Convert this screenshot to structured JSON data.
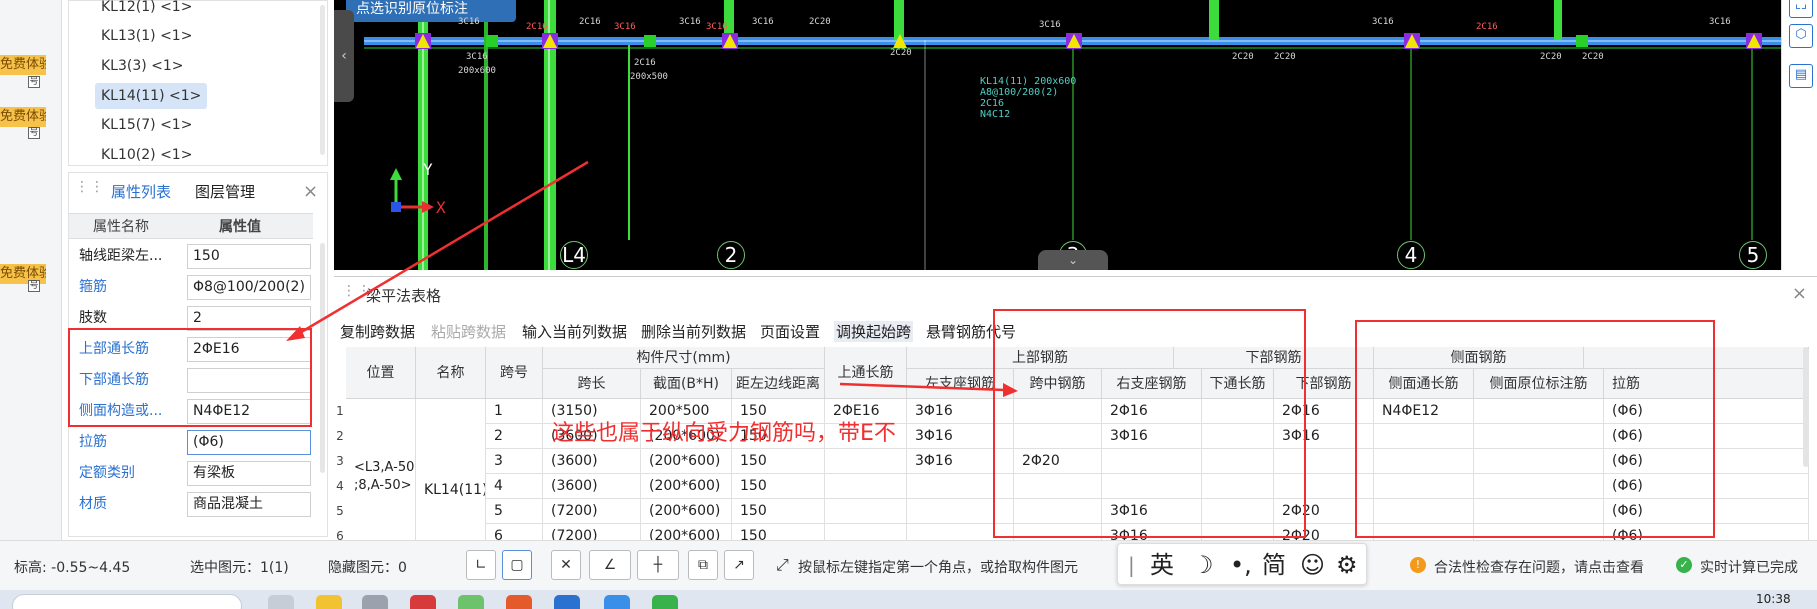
{
  "left_strip": {
    "promos": [
      "免费体验",
      "免费体验",
      "免费体验"
    ],
    "promo_icon": "号"
  },
  "component_list": {
    "items": [
      "KL12(1) <1>",
      "KL13(1) <1>",
      "KL3(3) <1>",
      "KL14(11) <1>",
      "KL15(7) <1>",
      "KL10(2) <1>"
    ],
    "selected_index": 3
  },
  "property_panel": {
    "tabs": [
      "属性列表",
      "图层管理"
    ],
    "active_tab": "属性列表",
    "header": {
      "name": "属性名称",
      "value": "属性值"
    },
    "rows": [
      {
        "name": "轴线距梁左...",
        "value": "150",
        "link": false
      },
      {
        "name": "箍筋",
        "value": "Φ8@100/200(2)",
        "link": true
      },
      {
        "name": "肢数",
        "value": "2",
        "link": false
      },
      {
        "name": "上部通长筋",
        "value": "2ΦE16",
        "link": true
      },
      {
        "name": "下部通长筋",
        "value": "",
        "link": true
      },
      {
        "name": "侧面构造或...",
        "value": "N4ΦE12",
        "link": true
      },
      {
        "name": "拉筋",
        "value": "(Φ6)",
        "link": true
      },
      {
        "name": "定额类别",
        "value": "有梁板",
        "link": true
      },
      {
        "name": "材质",
        "value": "商品混凝土",
        "link": true
      }
    ]
  },
  "cad": {
    "toolbar_button": "点选识别原位标注",
    "collapse_glyph": "‹",
    "collapse_bottom_glyph": "⌄",
    "axis_labels": [
      "L4",
      "2",
      "3",
      "4",
      "5"
    ],
    "ucs": {
      "x": "X",
      "y": "Y"
    },
    "beam_info": "KL14(11) 200x600\nA8@100/200(2)\n2C16\nN4C12",
    "tags": [
      "3C16",
      "2C16",
      "3C16",
      "3C16",
      "2C20",
      "3C16",
      "2C20",
      "3C16",
      "3C16",
      "2C20",
      "2C20",
      "3C16",
      "2C16"
    ],
    "red_tags": [
      "2C16",
      "3C16",
      "3C16",
      "2C16"
    ],
    "tags_bottom": [
      "200x600",
      "200x500",
      "2C20",
      "2C20"
    ]
  },
  "right_tools": [
    "⌞⌟",
    "⬡",
    "▤"
  ],
  "table_panel": {
    "title": "梁平法表格",
    "toolbar": [
      {
        "label": "复制跨数据",
        "state": "normal"
      },
      {
        "label": "粘贴跨数据",
        "state": "disabled"
      },
      {
        "label": "输入当前列数据",
        "state": "normal"
      },
      {
        "label": "删除当前列数据",
        "state": "normal"
      },
      {
        "label": "页面设置",
        "state": "normal"
      },
      {
        "label": "调换起始跨",
        "state": "selected"
      },
      {
        "label": "悬臂钢筋代号",
        "state": "normal"
      }
    ],
    "header_groups": {
      "position": "位置",
      "name": "名称",
      "span_no": "跨号",
      "size_group": "构件尺寸(mm)",
      "top_through": "上通长筋",
      "top_group": "上部钢筋",
      "bottom_group": "下部钢筋",
      "side_group": "侧面钢筋"
    },
    "subheaders": {
      "span_len": "跨长",
      "section": "截面(B*H)",
      "left_edge": "距左边线距离",
      "top_left": "左支座钢筋",
      "top_mid": "跨中钢筋",
      "top_right": "右支座钢筋",
      "bottom_through": "下通长筋",
      "bottom_bars": "下部钢筋",
      "side_through": "侧面通长筋",
      "side_orig": "侧面原位标注筋",
      "tie": "拉筋"
    },
    "merged_position": "<L3,A-50\n;8,A-50>",
    "merged_name": "KL14(11)",
    "rows": [
      {
        "no": "1",
        "span": "1",
        "len": "(3150)",
        "sec": "200*500",
        "dist": "150",
        "top_through": "2ΦE16",
        "tl": "3Φ16",
        "tm": "",
        "tr": "2Φ16",
        "bt": "",
        "bb": "2Φ16",
        "st": "N4ΦE12",
        "so": "",
        "tie": "(Φ6)"
      },
      {
        "no": "2",
        "span": "2",
        "len": "(3600)",
        "sec": "(200*600)",
        "dist": "150",
        "top_through": "",
        "tl": "3Φ16",
        "tm": "",
        "tr": "3Φ16",
        "bt": "",
        "bb": "3Φ16",
        "st": "",
        "so": "",
        "tie": "(Φ6)"
      },
      {
        "no": "3",
        "span": "3",
        "len": "(3600)",
        "sec": "(200*600)",
        "dist": "150",
        "top_through": "",
        "tl": "3Φ16",
        "tm": "2Φ20",
        "tr": "",
        "bt": "",
        "bb": "",
        "st": "",
        "so": "",
        "tie": "(Φ6)"
      },
      {
        "no": "4",
        "span": "4",
        "len": "(3600)",
        "sec": "(200*600)",
        "dist": "150",
        "top_through": "",
        "tl": "",
        "tm": "",
        "tr": "",
        "bt": "",
        "bb": "",
        "st": "",
        "so": "",
        "tie": "(Φ6)"
      },
      {
        "no": "5",
        "span": "5",
        "len": "(7200)",
        "sec": "(200*600)",
        "dist": "150",
        "top_through": "",
        "tl": "",
        "tm": "",
        "tr": "3Φ16",
        "bt": "",
        "bb": "2Φ20",
        "st": "",
        "so": "",
        "tie": "(Φ6)"
      },
      {
        "no": "6",
        "span": "6",
        "len": "(7200)",
        "sec": "(200*600)",
        "dist": "150",
        "top_through": "",
        "tl": "",
        "tm": "",
        "tr": "3Φ16",
        "bt": "",
        "bb": "2Φ20",
        "st": "",
        "so": "",
        "tie": "(Φ6)"
      }
    ]
  },
  "annotation": {
    "question": "这些也属于纵向受力钢筋吗，带E不",
    "color": "#f03030"
  },
  "status_bar": {
    "elevation": "标高:  -0.55~4.45",
    "selected": "选中图元：1(1)",
    "hidden": "隐藏图元：0",
    "hint": "按鼠标左键指定第一个角点，或拾取构件图元",
    "warning": "合法性检查存在问题，请点击查看",
    "realtime": "实时计算已完成",
    "tool_glyphs": [
      "∟",
      "▢",
      "✕",
      "∠",
      "┼",
      "⧉",
      "↗"
    ]
  },
  "ime": {
    "items": [
      "英",
      "☽",
      "•,",
      "简",
      "☺",
      "⚙"
    ]
  },
  "taskbar": {
    "clock": "10:38"
  },
  "colors": {
    "accent": "#2a71d0",
    "annotation": "#f03030",
    "cad_bg": "#000000",
    "beam_green": "#3ddc3d",
    "beam_blue": "#3a8fe8",
    "marker_yellow": "#f2e600"
  }
}
